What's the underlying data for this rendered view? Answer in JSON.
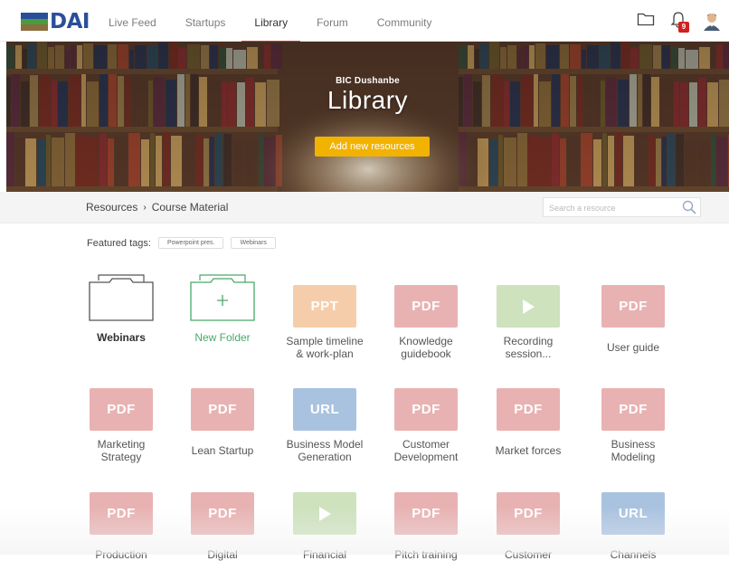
{
  "header": {
    "logo_text": "DAI",
    "logo_colors": [
      "#2a4f9a",
      "#4a9d3f",
      "#8b6d3f"
    ],
    "nav": [
      "Live Feed",
      "Startups",
      "Library",
      "Forum",
      "Community"
    ],
    "active_nav": "Library",
    "notification_count": "9"
  },
  "hero": {
    "subtitle": "BIC Dushanbe",
    "title": "Library",
    "button": "Add new resources"
  },
  "breadcrumb": {
    "items": [
      "Resources",
      "Course Material"
    ],
    "separator": "›"
  },
  "search": {
    "placeholder": "Search a resource"
  },
  "tags": {
    "label": "Featured tags:",
    "items": [
      "Powerpoint pres.",
      "Webinars"
    ]
  },
  "files": [
    {
      "kind": "folder",
      "label": "Webinars"
    },
    {
      "kind": "new",
      "label": "New Folder"
    },
    {
      "kind": "ppt",
      "badge": "PPT",
      "label": "Sample timeline\n& work-plan"
    },
    {
      "kind": "pdf",
      "badge": "PDF",
      "label": "Knowledge\nguidebook"
    },
    {
      "kind": "vid",
      "badge": "",
      "label": "Recording\nsession..."
    },
    {
      "kind": "pdf",
      "badge": "PDF",
      "label": "User guide"
    },
    {
      "kind": "pdf",
      "badge": "PDF",
      "label": "Marketing\nStrategy"
    },
    {
      "kind": "pdf",
      "badge": "PDF",
      "label": "Lean Startup"
    },
    {
      "kind": "url",
      "badge": "URL",
      "label": "Business Model\nGeneration"
    },
    {
      "kind": "pdf",
      "badge": "PDF",
      "label": "Customer\nDevelopment"
    },
    {
      "kind": "pdf",
      "badge": "PDF",
      "label": "Market forces"
    },
    {
      "kind": "pdf",
      "badge": "PDF",
      "label": "Business\nModeling"
    },
    {
      "kind": "pdf",
      "badge": "PDF",
      "label": "Production"
    },
    {
      "kind": "pdf",
      "badge": "PDF",
      "label": "Digital"
    },
    {
      "kind": "vid",
      "badge": "",
      "label": "Financial"
    },
    {
      "kind": "pdf",
      "badge": "PDF",
      "label": "Pitch training"
    },
    {
      "kind": "pdf",
      "badge": "PDF",
      "label": "Customer"
    },
    {
      "kind": "url",
      "badge": "URL",
      "label": "Channels"
    }
  ]
}
